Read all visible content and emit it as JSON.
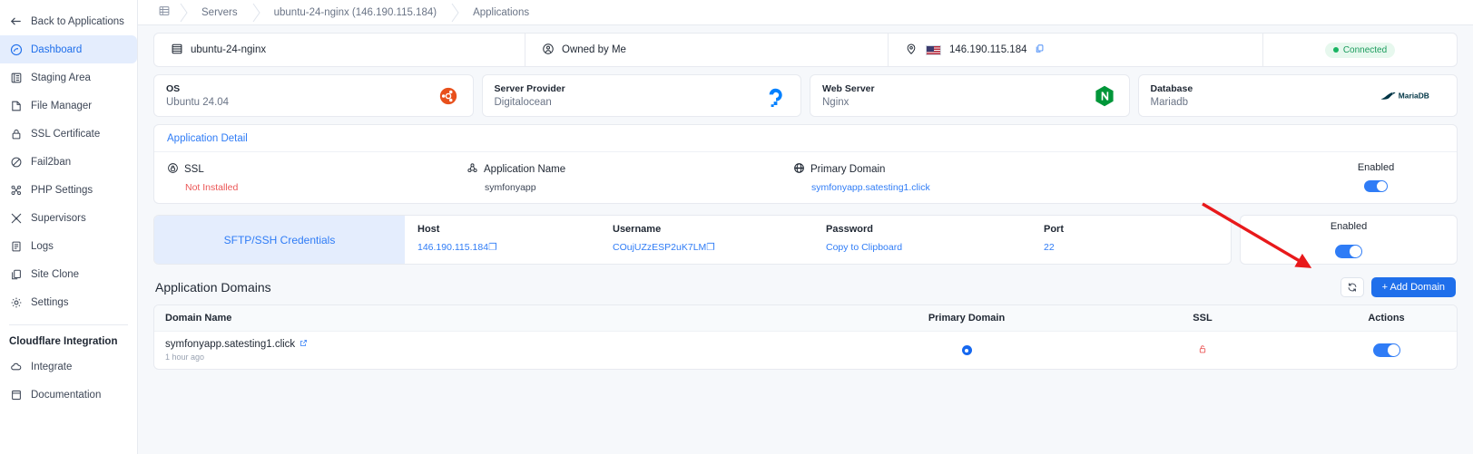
{
  "sidebar": {
    "back": {
      "label": "Back to Applications",
      "icon": "arrow-left-icon"
    },
    "items": [
      {
        "label": "Dashboard",
        "icon": "dashboard-icon",
        "active": true
      },
      {
        "label": "Staging Area",
        "icon": "staging-icon",
        "active": false
      },
      {
        "label": "File Manager",
        "icon": "file-icon",
        "active": false
      },
      {
        "label": "SSL Certificate",
        "icon": "lock-icon",
        "active": false
      },
      {
        "label": "Fail2ban",
        "icon": "ban-icon",
        "active": false
      },
      {
        "label": "PHP Settings",
        "icon": "nodes-icon",
        "active": false
      },
      {
        "label": "Supervisors",
        "icon": "supervisor-icon",
        "active": false
      },
      {
        "label": "Logs",
        "icon": "logs-icon",
        "active": false
      },
      {
        "label": "Site Clone",
        "icon": "clone-icon",
        "active": false
      },
      {
        "label": "Settings",
        "icon": "gear-icon",
        "active": false
      }
    ],
    "section_title": "Cloudflare Integration",
    "section_items": [
      {
        "label": "Integrate",
        "icon": "cloud-icon"
      },
      {
        "label": "Documentation",
        "icon": "book-icon"
      }
    ]
  },
  "breadcrumb": {
    "home_icon": "servers-grid-icon",
    "items": [
      "Servers",
      "ubuntu-24-nginx (146.190.115.184)",
      "Applications"
    ]
  },
  "summary": {
    "server_name": "ubuntu-24-nginx",
    "server_icon": "server-icon",
    "owner": "Owned by Me",
    "owner_icon": "user-circle-icon",
    "location_icon": "map-pin-icon",
    "flag": "us-flag",
    "ip": "146.190.115.184",
    "copy_icon": "copy-icon",
    "status": "Connected",
    "status_color": "#19b462"
  },
  "specs": [
    {
      "label": "OS",
      "value": "Ubuntu 24.04",
      "logo": "ubuntu-logo"
    },
    {
      "label": "Server Provider",
      "value": "Digitalocean",
      "logo": "digitalocean-logo"
    },
    {
      "label": "Web Server",
      "value": "Nginx",
      "logo": "nginx-logo"
    },
    {
      "label": "Database",
      "value": "Mariadb",
      "logo": "mariadb-logo"
    }
  ],
  "application_detail": {
    "title": "Application Detail",
    "ssl": {
      "label": "SSL",
      "icon": "ssl-shield-icon",
      "value": "Not Installed",
      "value_color": "#eb5757"
    },
    "app_name": {
      "label": "Application Name",
      "icon": "app-icon",
      "value": "symfonyapp"
    },
    "primary_domain": {
      "label": "Primary Domain",
      "icon": "globe-icon",
      "value": "symfonyapp.satesting1.click",
      "value_color": "#2f7cf6"
    },
    "toggle": {
      "label": "Enabled",
      "on": true
    }
  },
  "sftp": {
    "title": "SFTP/SSH Credentials",
    "fields": [
      {
        "label": "Host",
        "value": "146.190.115.184",
        "copy": true
      },
      {
        "label": "Username",
        "value": "COujUZzESP2uK7LM",
        "copy": true
      },
      {
        "label": "Password",
        "value": "Copy to Clipboard",
        "copy": false
      },
      {
        "label": "Port",
        "value": "22",
        "copy": false
      }
    ],
    "toggle": {
      "label": "Enabled",
      "on": true
    }
  },
  "domains": {
    "title": "Application Domains",
    "refresh_icon": "refresh-icon",
    "add_label": "+ Add Domain",
    "columns": [
      "Domain Name",
      "Primary Domain",
      "SSL",
      "Actions"
    ],
    "rows": [
      {
        "domain": "symfonyapp.satesting1.click",
        "external_icon": "external-link-icon",
        "ago": "1 hour ago",
        "primary": true,
        "ssl_icon": "unlock-icon",
        "ssl_color": "#eb5757",
        "enabled": true
      }
    ]
  },
  "annotation": {
    "type": "red-arrow",
    "color": "#e8191b"
  }
}
